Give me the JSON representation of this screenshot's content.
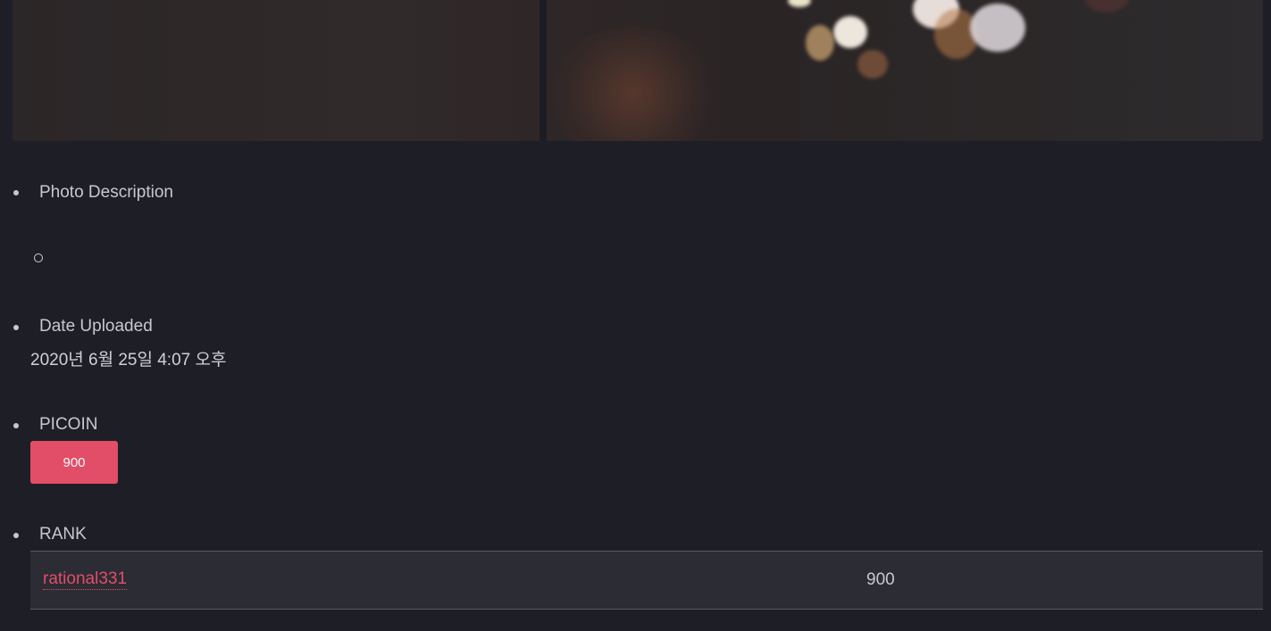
{
  "photo": {
    "alt_icon": "bokeh-photo"
  },
  "details": {
    "description_label": "Photo Description",
    "date_label": "Date Uploaded",
    "date_value": "2020년 6월 25일 4:07 오후",
    "picoin_label": "PICOIN",
    "picoin_value": "900",
    "rank_label": "RANK",
    "rank_rows": [
      {
        "user": "rational331",
        "score": "900"
      }
    ]
  },
  "colors": {
    "background": "#1e1e27",
    "accent": "#e24d67",
    "table_row": "#2c2c35",
    "text": "#c8c8cc"
  }
}
